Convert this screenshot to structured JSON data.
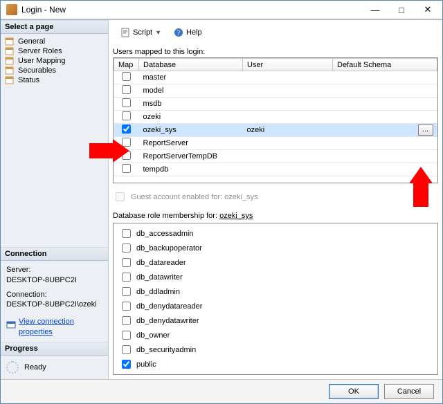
{
  "window": {
    "title": "Login - New"
  },
  "sidebar": {
    "select_page_header": "Select a page",
    "items": [
      {
        "label": "General"
      },
      {
        "label": "Server Roles"
      },
      {
        "label": "User Mapping"
      },
      {
        "label": "Securables"
      },
      {
        "label": "Status"
      }
    ],
    "connection_header": "Connection",
    "connection": {
      "server_label": "Server:",
      "server_value": "DESKTOP-8UBPC2I",
      "connection_label": "Connection:",
      "connection_value": "DESKTOP-8UBPC2I\\ozeki",
      "view_props": "View connection properties"
    },
    "progress_header": "Progress",
    "progress_status": "Ready"
  },
  "toolbar": {
    "script_label": "Script",
    "help_label": "Help"
  },
  "mappings_label": "Users mapped to this login:",
  "columns": {
    "map": "Map",
    "database": "Database",
    "user": "User",
    "schema": "Default Schema"
  },
  "rows": [
    {
      "checked": false,
      "database": "master",
      "user": "",
      "schema": "",
      "selected": false
    },
    {
      "checked": false,
      "database": "model",
      "user": "",
      "schema": "",
      "selected": false
    },
    {
      "checked": false,
      "database": "msdb",
      "user": "",
      "schema": "",
      "selected": false
    },
    {
      "checked": false,
      "database": "ozeki",
      "user": "",
      "schema": "",
      "selected": false
    },
    {
      "checked": true,
      "database": "ozeki_sys",
      "user": "ozeki",
      "schema": "",
      "selected": true
    },
    {
      "checked": false,
      "database": "ReportServer",
      "user": "",
      "schema": "",
      "selected": false
    },
    {
      "checked": false,
      "database": "ReportServerTempDB",
      "user": "",
      "schema": "",
      "selected": false
    },
    {
      "checked": false,
      "database": "tempdb",
      "user": "",
      "schema": "",
      "selected": false
    }
  ],
  "guest_label": "Guest account enabled for: ozeki_sys",
  "roles_label_prefix": "Database role membership for: ",
  "roles_label_db": "ozeki_sys",
  "roles": [
    {
      "name": "db_accessadmin",
      "checked": false
    },
    {
      "name": "db_backupoperator",
      "checked": false
    },
    {
      "name": "db_datareader",
      "checked": false
    },
    {
      "name": "db_datawriter",
      "checked": false
    },
    {
      "name": "db_ddladmin",
      "checked": false
    },
    {
      "name": "db_denydatareader",
      "checked": false
    },
    {
      "name": "db_denydatawriter",
      "checked": false
    },
    {
      "name": "db_owner",
      "checked": false
    },
    {
      "name": "db_securityadmin",
      "checked": false
    },
    {
      "name": "public",
      "checked": true
    }
  ],
  "footer": {
    "ok": "OK",
    "cancel": "Cancel"
  }
}
